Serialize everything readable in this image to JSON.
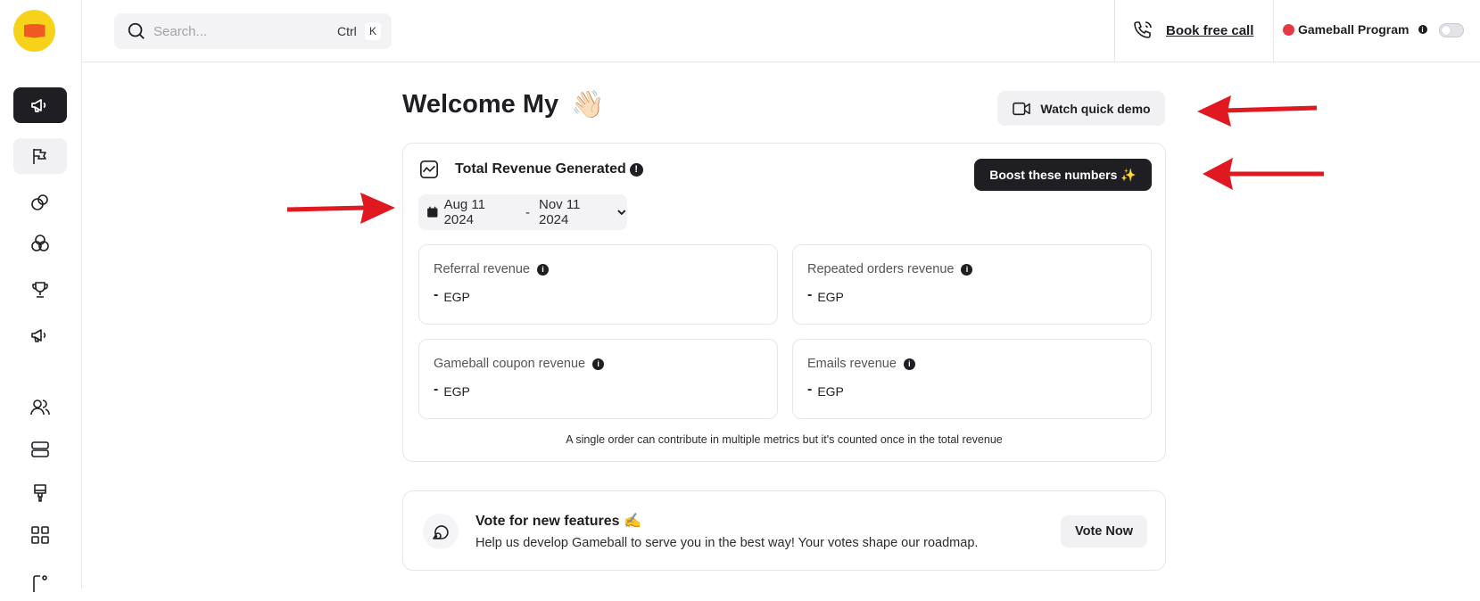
{
  "brand": {
    "logo_name": "gameball-logo",
    "colors": {
      "accent": "#f7d21a",
      "flag": "#f05a22",
      "dark": "#1f1f23",
      "status_red": "#e53946",
      "arrow_red": "#e0181f"
    }
  },
  "search": {
    "placeholder": "Search...",
    "shortcut_ctrl": "Ctrl",
    "shortcut_key": "K"
  },
  "header": {
    "book_call": "Book free call",
    "program_label": "Gameball Program",
    "program_enabled": false
  },
  "welcome": {
    "title": "Welcome My",
    "emoji": "👋🏻"
  },
  "demo": {
    "label": "Watch quick demo"
  },
  "revenue": {
    "title": "Total Revenue Generated",
    "boost_label": "Boost these numbers ✨",
    "date_from": "Aug 11 2024",
    "date_sep": "-",
    "date_to": "Nov 11 2024",
    "metrics": [
      {
        "label": "Referral revenue",
        "value": "-",
        "currency": "EGP"
      },
      {
        "label": "Repeated orders revenue",
        "value": "-",
        "currency": "EGP"
      },
      {
        "label": "Gameball coupon revenue",
        "value": "-",
        "currency": "EGP"
      },
      {
        "label": "Emails revenue",
        "value": "-",
        "currency": "EGP"
      }
    ],
    "footnote": "A single order can contribute in multiple metrics but it's counted once in the total revenue"
  },
  "vote": {
    "title": "Vote for new features ✍️",
    "description": "Help us develop Gameball to serve you in the best way! Your votes shape our roadmap.",
    "button": "Vote Now"
  },
  "sidebar": {
    "items": [
      {
        "icon": "megaphone-icon",
        "state": "active"
      },
      {
        "icon": "flags-icon",
        "state": "hover"
      },
      {
        "icon": "circles-icon",
        "state": "normal"
      },
      {
        "icon": "three-circles-icon",
        "state": "normal"
      },
      {
        "icon": "trophy-icon",
        "state": "normal"
      },
      {
        "icon": "megaphone-outline-icon",
        "state": "normal"
      },
      {
        "icon": "users-icon",
        "state": "normal"
      },
      {
        "icon": "server-icon",
        "state": "normal"
      },
      {
        "icon": "brush-icon",
        "state": "normal"
      },
      {
        "icon": "apps-grid-icon",
        "state": "normal"
      },
      {
        "icon": "integration-icon",
        "state": "normal"
      }
    ]
  }
}
